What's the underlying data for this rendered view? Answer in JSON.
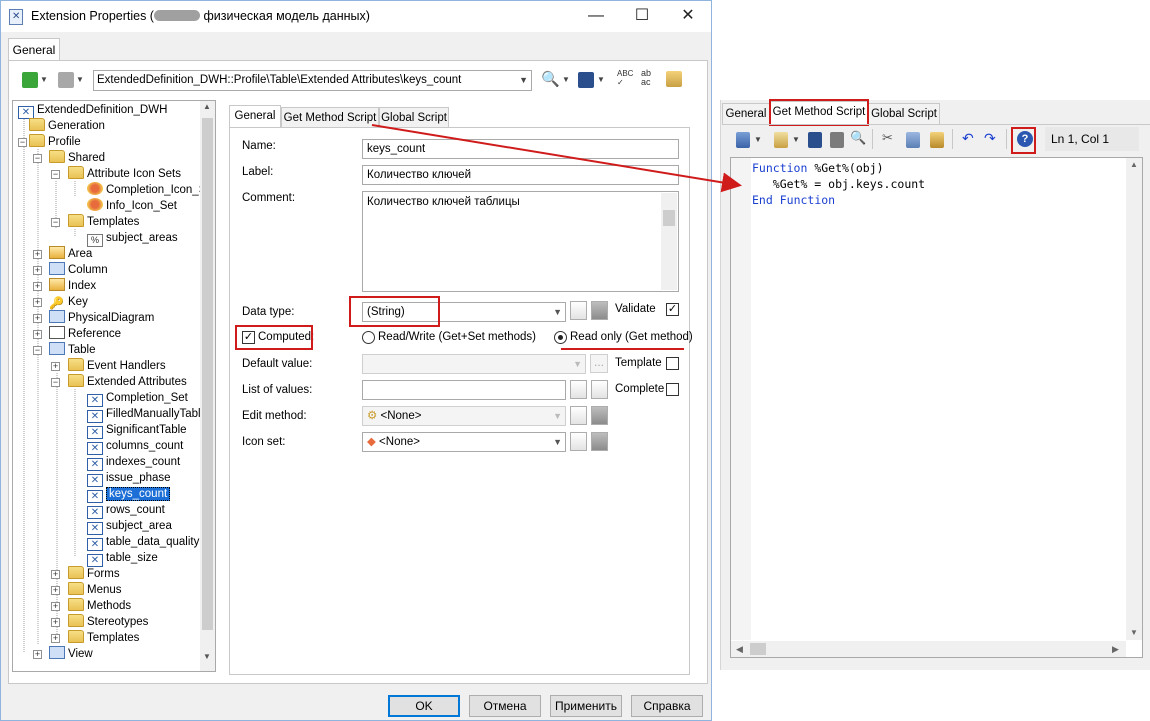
{
  "window": {
    "title_prefix": "Extension Properties (",
    "title_suffix": " физическая модель данных)",
    "minimize": "—",
    "maximize": "☐",
    "close": "✕"
  },
  "outer_tab": "General",
  "toolbar": {
    "path": "ExtendedDefinition_DWH::Profile\\Table\\Extended Attributes\\keys_count"
  },
  "tree": {
    "nodes": [
      {
        "label": "ExtendedDefinition_DWH"
      },
      {
        "label": "Generation"
      },
      {
        "label": "Profile"
      },
      {
        "label": "Shared"
      },
      {
        "label": "Attribute Icon Sets"
      },
      {
        "label": "Completion_Icon_Se"
      },
      {
        "label": "Info_Icon_Set"
      },
      {
        "label": "Templates"
      },
      {
        "label": "subject_areas"
      },
      {
        "label": "Area"
      },
      {
        "label": "Column"
      },
      {
        "label": "Index"
      },
      {
        "label": "Key"
      },
      {
        "label": "PhysicalDiagram"
      },
      {
        "label": "Reference"
      },
      {
        "label": "Table"
      },
      {
        "label": "Event Handlers"
      },
      {
        "label": "Extended Attributes"
      },
      {
        "label": "Completion_Set"
      },
      {
        "label": "FilledManuallyTable"
      },
      {
        "label": "SignificantTable"
      },
      {
        "label": "columns_count"
      },
      {
        "label": "indexes_count"
      },
      {
        "label": "issue_phase"
      },
      {
        "label": "keys_count"
      },
      {
        "label": "rows_count"
      },
      {
        "label": "subject_area"
      },
      {
        "label": "table_data_quality"
      },
      {
        "label": "table_size"
      },
      {
        "label": "Forms"
      },
      {
        "label": "Menus"
      },
      {
        "label": "Methods"
      },
      {
        "label": "Stereotypes"
      },
      {
        "label": "Templates"
      },
      {
        "label": "View"
      }
    ]
  },
  "prop_tabs": [
    "General",
    "Get Method Script",
    "Global Script"
  ],
  "form": {
    "name_label": "Name:",
    "name_value": "keys_count",
    "label_label": "Label:",
    "label_value": "Количество ключей",
    "comment_label": "Comment:",
    "comment_value": "Количество ключей таблицы",
    "datatype_label": "Data type:",
    "datatype_value": "(String)",
    "validate_label": "Validate",
    "computed_label": "Computed:",
    "rw_label": "Read/Write (Get+Set methods)",
    "ro_label": "Read only (Get method)",
    "default_label": "Default value:",
    "default_value": "",
    "dots": "...",
    "template_label": "Template",
    "list_label": "List of values:",
    "list_value": "",
    "complete_label": "Complete",
    "edit_label": "Edit method:",
    "edit_value": "<None>",
    "iconset_label": "Icon set:",
    "iconset_value": "<None>"
  },
  "buttons": {
    "ok": "OK",
    "cancel": "Отмена",
    "apply": "Применить",
    "help": "Справка"
  },
  "script_panel": {
    "tabs": [
      "General",
      "Get Method Script",
      "Global Script"
    ],
    "position": "Ln 1, Col 1",
    "code_line1_kw": "Function",
    "code_line1_rest": " %Get%(obj)",
    "code_line2": "   %Get% = obj.keys.count",
    "code_line3_kw1": "End",
    "code_line3_kw2": "Function"
  },
  "colors": {
    "highlight_red": "#d01b1b",
    "selection_blue": "#1c6fd6",
    "keyword_blue": "#1a3fd0"
  }
}
